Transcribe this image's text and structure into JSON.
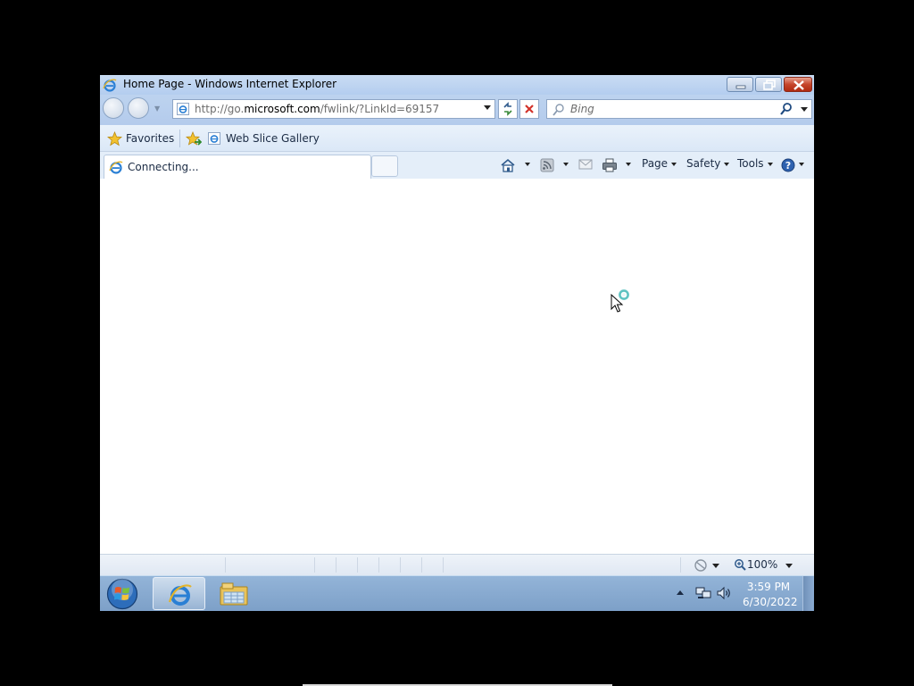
{
  "window": {
    "title": "Home Page - Windows Internet Explorer"
  },
  "navigation": {
    "address_prefix": "http://go.",
    "address_host": "microsoft.com",
    "address_path": "/fwlink/?LinkId=69157",
    "search_placeholder": "Bing"
  },
  "favorites_bar": {
    "favorites_label": "Favorites",
    "items": [
      {
        "label": "Web Slice Gallery"
      }
    ]
  },
  "tab": {
    "label": "Connecting..."
  },
  "command_bar": {
    "page_label": "Page",
    "safety_label": "Safety",
    "tools_label": "Tools"
  },
  "status_bar": {
    "zoom": "100%"
  },
  "taskbar": {
    "clock_time": "3:59 PM",
    "clock_date": "6/30/2022"
  },
  "colors": {
    "title_bar": "#c9dcf3",
    "close_button": "#c6452c",
    "ie_blue": "#2a7fd4",
    "taskbar": "#93b4d8"
  }
}
